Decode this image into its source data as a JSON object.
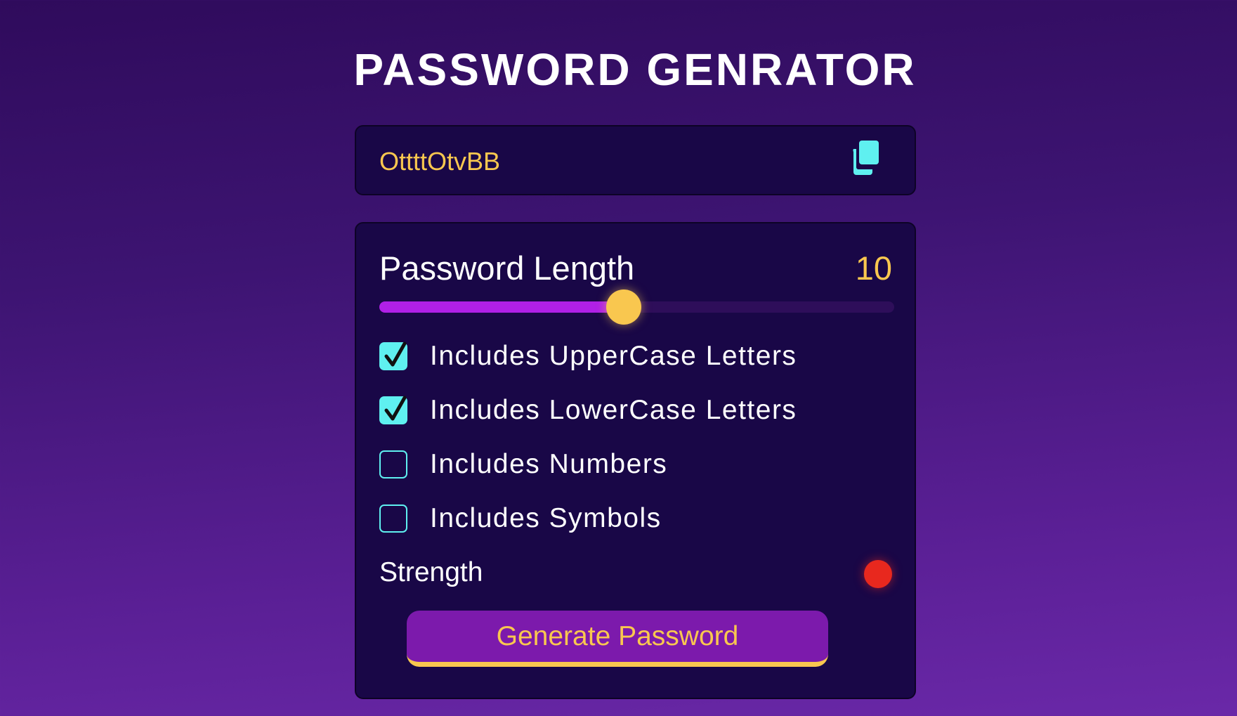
{
  "title": "PASSWORD GENRATOR",
  "display": {
    "password": "OttttOtvBB",
    "copy_icon": "copy-icon"
  },
  "length": {
    "label": "Password Length",
    "value": "10",
    "slider_fraction": 0.475
  },
  "options": [
    {
      "label": "Includes UpperCase Letters",
      "checked": true
    },
    {
      "label": "Includes LowerCase Letters",
      "checked": true
    },
    {
      "label": "Includes Numbers",
      "checked": false
    },
    {
      "label": "Includes Symbols",
      "checked": false
    }
  ],
  "strength": {
    "label": "Strength",
    "indicator_color": "#e8281e"
  },
  "generate_button": {
    "label": "Generate Password"
  },
  "colors": {
    "accent_yellow": "#f9c74f",
    "accent_cyan": "#5ff0f0",
    "accent_purple": "#b020e6",
    "panel_bg": "#190747"
  }
}
